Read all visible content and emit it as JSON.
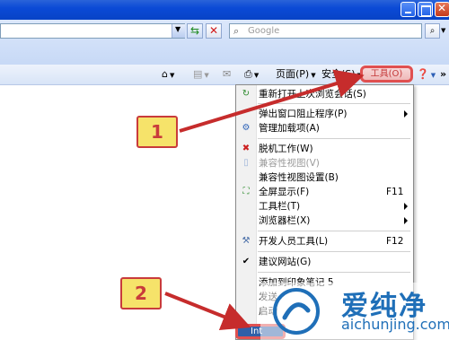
{
  "search": {
    "placeholder": "Google"
  },
  "commandbar": {
    "page_label": "页面(P)",
    "safety_label": "安全(S)",
    "tools_label": "工具(O)"
  },
  "tools_menu": {
    "items": [
      {
        "label": "重新打开上次浏览会话(S)",
        "shortcut": "",
        "submenu": false,
        "disabled": false,
        "icon": "reopen-session-icon"
      },
      {
        "label": "弹出窗口阻止程序(P)",
        "shortcut": "",
        "submenu": true,
        "disabled": false,
        "icon": ""
      },
      {
        "label": "管理加载项(A)",
        "shortcut": "",
        "submenu": false,
        "disabled": false,
        "icon": "addons-icon"
      },
      {
        "label": "脱机工作(W)",
        "shortcut": "",
        "submenu": false,
        "disabled": false,
        "icon": "offline-icon"
      },
      {
        "label": "兼容性视图(V)",
        "shortcut": "",
        "submenu": false,
        "disabled": true,
        "icon": "compat-view-icon"
      },
      {
        "label": "兼容性视图设置(B)",
        "shortcut": "",
        "submenu": false,
        "disabled": false,
        "icon": ""
      },
      {
        "label": "全屏显示(F)",
        "shortcut": "F11",
        "submenu": false,
        "disabled": false,
        "icon": "fullscreen-icon"
      },
      {
        "label": "工具栏(T)",
        "shortcut": "",
        "submenu": true,
        "disabled": false,
        "icon": ""
      },
      {
        "label": "浏览器栏(X)",
        "shortcut": "",
        "submenu": true,
        "disabled": false,
        "icon": ""
      },
      {
        "label": "开发人员工具(L)",
        "shortcut": "F12",
        "submenu": false,
        "disabled": false,
        "icon": "developer-tools-icon"
      },
      {
        "label": "建议网站(G)",
        "shortcut": "",
        "submenu": false,
        "disabled": false,
        "icon": "checkmark-icon"
      },
      {
        "label": "添加到印象笔记 5",
        "shortcut": "",
        "submenu": false,
        "disabled": false,
        "icon": ""
      },
      {
        "label": "发送",
        "shortcut": "",
        "submenu": false,
        "disabled": false,
        "icon": ""
      },
      {
        "label": "启动",
        "shortcut": "",
        "submenu": false,
        "disabled": false,
        "icon": ""
      }
    ],
    "last_item_label": "Int"
  },
  "annotations": {
    "step1": "1",
    "step2": "2",
    "arrow_color": "#c62c2c",
    "badge_fill": "#f6e36a"
  },
  "watermark": {
    "cn": "爱纯净",
    "en": "aichunjing.com"
  }
}
